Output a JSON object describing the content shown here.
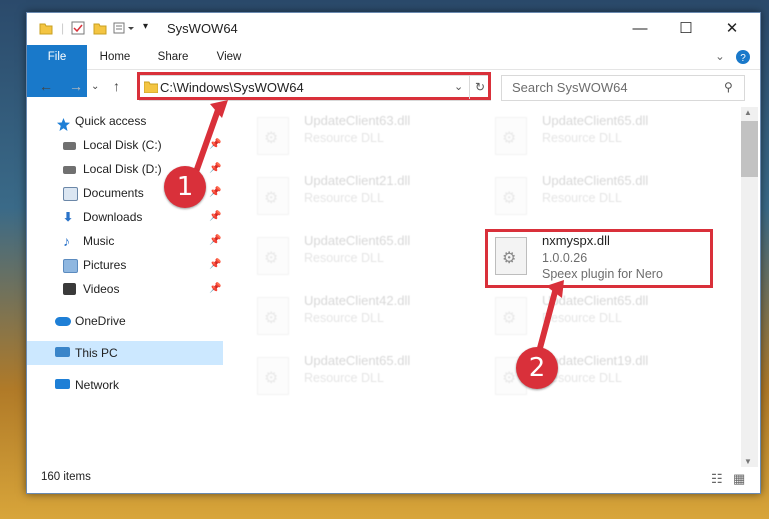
{
  "window": {
    "title": "SysWOW64",
    "minimize": "—",
    "maximize": "☐",
    "close": "✕"
  },
  "ribbon": {
    "tabs": [
      "File",
      "Home",
      "Share",
      "View"
    ]
  },
  "address": {
    "path": "C:\\Windows\\SysWOW64",
    "search_placeholder": "Search SysWOW64"
  },
  "nav": {
    "items": [
      {
        "label": "Quick access",
        "color": "#1e7fd6"
      },
      {
        "label": "Local Disk (C:)",
        "color": "#707070"
      },
      {
        "label": "Local Disk (D:)",
        "color": "#707070"
      },
      {
        "label": "Documents",
        "color": "#6b87a8"
      },
      {
        "label": "Downloads",
        "color": "#2a73c9"
      },
      {
        "label": "Music",
        "color": "#2a73c9"
      },
      {
        "label": "Pictures",
        "color": "#5b8bbf"
      },
      {
        "label": "Videos",
        "color": "#3a3a3a"
      },
      {
        "label": "OneDrive",
        "color": "#1e7fd6"
      },
      {
        "label": "This PC",
        "color": "#3a85c9"
      },
      {
        "label": "Network",
        "color": "#1e7fd6"
      }
    ]
  },
  "files": [
    {
      "name": "UpdateClient63.dll",
      "line1": "Resource DLL"
    },
    {
      "name": "UpdateClient65.dll",
      "line1": "Resource DLL"
    },
    {
      "name": "UpdateClient21.dll",
      "line1": "Resource DLL"
    },
    {
      "name": "UpdateClient65.dll",
      "line1": "Resource DLL"
    },
    {
      "name": "UpdateClient65.dll",
      "line1": "Resource DLL"
    },
    {
      "name": "nxmyspx.dll",
      "line1": "1.0.0.26",
      "line2": "Speex plugin for Nero"
    },
    {
      "name": "UpdateClient42.dll",
      "line1": "Resource DLL"
    },
    {
      "name": "UpdateClient65.dll",
      "line1": "Resource DLL"
    },
    {
      "name": "UpdateClient65.dll",
      "line1": "Resource DLL"
    },
    {
      "name": "UpdateClient19.dll",
      "line1": "Resource DLL"
    }
  ],
  "status": {
    "count": "160 items"
  },
  "callouts": [
    "1",
    "2"
  ],
  "colors": {
    "highlight": "#d9303a",
    "accent": "#1979ca",
    "selection": "#cce8ff"
  }
}
